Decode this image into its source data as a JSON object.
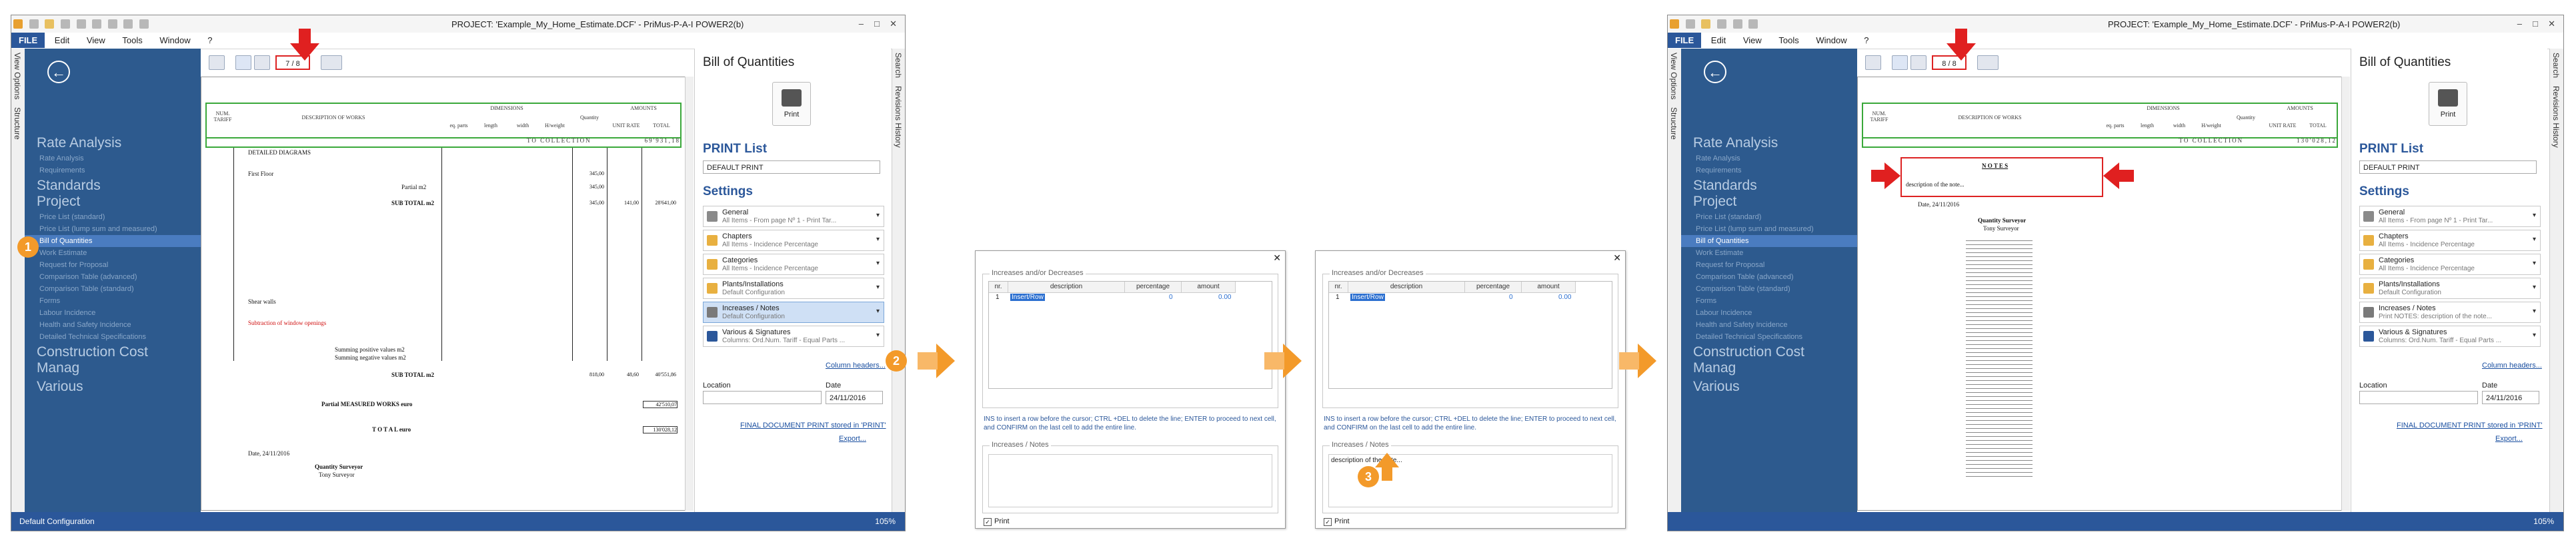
{
  "colors": {
    "accent": "#2b579a",
    "panel": "#2d5a8e",
    "highlight": "#e02020",
    "callout": "#f39a2a",
    "table_border": "#3aa83a"
  },
  "app": {
    "title": "PROJECT: 'Example_My_Home_Estimate.DCF' - PriMus-P-A-I   POWER2(b)",
    "title_short": "PROJECT: 'Example_My_Home_Estimate.DCF' - PriMus-P-A-I   POWER2(b)",
    "menu": [
      "FILE",
      "Edit",
      "View",
      "Tools",
      "Window",
      "?"
    ],
    "side_tabs": [
      "View Options",
      "Structure"
    ],
    "right_tabs": [
      "Search",
      "Revisions History"
    ],
    "status_left": "Default Configuration",
    "zoom": "105%"
  },
  "nav": {
    "headings": [
      "Rate Analysis",
      "Standards Project",
      "Construction Cost Manag",
      "Various"
    ],
    "rate_items": [
      "Rate Analysis",
      "Requirements"
    ],
    "standards_items": [
      "Price List (standard)",
      "Price List (lump sum and measured)",
      "Bill of Quantities",
      "Work Estimate",
      "Request for Proposal",
      "Comparison Table (advanced)",
      "Comparison Table (standard)",
      "Forms",
      "Labour Incidence",
      "Health and Safety Incidence",
      "Detailed Technical Specifications"
    ],
    "selected": "Bill of Quantities"
  },
  "toolbar": {
    "page_a": "7",
    "page_sep": "/",
    "page_total": "8",
    "page_b": "8"
  },
  "doc": {
    "headers": {
      "num": "NUM. TARIFF",
      "desc": "DESCRIPTION OF WORKS",
      "dimensions": "DIMENSIONS",
      "dims": [
        "eq. parts",
        "length",
        "width",
        "H/weight"
      ],
      "quantity": "Quantity",
      "amounts": "AMOUNTS",
      "amts": [
        "UNIT RATE",
        "TOTAL"
      ]
    },
    "collection": "TO COLLECTION",
    "collection_total_a": "69'931,18",
    "collection_total_b": "130'028,12",
    "lines": [
      "DETAILED DIAGRAMS",
      "First Floor",
      "Partial m2",
      "SUB TOTAL m2",
      "Shear walls",
      "Subtraction of window openings",
      "Summing positive values m2",
      "Summing negative values m2",
      "SUB TOTAL m2",
      "Partial MEASURED WORKS euro",
      "T O T A L  euro",
      "Date, 24/11/2016",
      "Quantity Surveyor",
      "Tony Surveyor"
    ],
    "numbers": [
      "345,00",
      "345,00",
      "345,00",
      "141,00",
      "28'641,00",
      "818,00",
      "48,60",
      "40'551,86",
      "42'510,07",
      "130'028,12"
    ],
    "notes_title": "N O T E S",
    "notes_text": "description of the note..."
  },
  "print": {
    "panel_title": "Bill of Quantities",
    "print_label": "Print",
    "list_label": "PRINT List",
    "default_print": "DEFAULT PRINT",
    "settings_label": "Settings",
    "settings": [
      {
        "title": "General",
        "sub": "All Items - From page Nº 1 - Print Tar..."
      },
      {
        "title": "Chapters",
        "sub": "All Items - Incidence Percentage"
      },
      {
        "title": "Categories",
        "sub": "All Items - Incidence Percentage"
      },
      {
        "title": "Plants/Installations",
        "sub": "Default Configuration"
      },
      {
        "title": "Increases / Notes",
        "sub": "Default Configuration"
      },
      {
        "title": "Various & Signatures",
        "sub": "Columns: Ord.Num. Tariff - Equal Parts ..."
      }
    ],
    "settings_right": [
      {
        "title": "General",
        "sub": "All Items - From page Nº 1 - Print Tar..."
      },
      {
        "title": "Chapters",
        "sub": "All Items - Incidence Percentage"
      },
      {
        "title": "Categories",
        "sub": "All Items - Incidence Percentage"
      },
      {
        "title": "Plants/Installations",
        "sub": "Default Configuration"
      },
      {
        "title": "Increases / Notes",
        "sub": "Print NOTES: description of the note..."
      },
      {
        "title": "Various & Signatures",
        "sub": "Columns: Ord.Num. Tariff - Equal Parts ..."
      }
    ],
    "column_headers_link": "Column headers...",
    "location_label": "Location",
    "date_label": "Date",
    "date_value": "24/11/2016",
    "final_doc": "FINAL DOCUMENT PRINT stored in 'PRINT'",
    "export": "Export..."
  },
  "dialog": {
    "increases_label": "Increases and/or Decreases",
    "cols": [
      "nr.",
      "description",
      "percentage",
      "amount"
    ],
    "row_nr": "1",
    "row_desc": "Insert/Row",
    "row_pct": "0",
    "row_amt": "0.00",
    "hint": "INS to insert a row before the cursor; CTRL +DEL to delete the line; ENTER to proceed to next cell, and CONFIRM on the last cell to add the entire line.",
    "notes_label": "Increases / Notes",
    "notes_text": "description of the note...",
    "print_check": "Print"
  },
  "badges": [
    "1",
    "2",
    "3"
  ]
}
